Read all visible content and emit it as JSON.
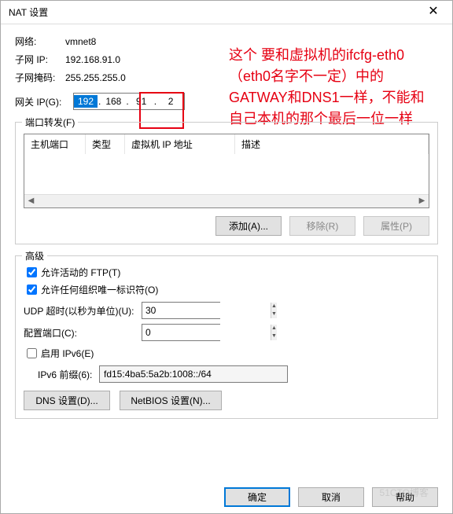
{
  "titlebar": {
    "title": "NAT 设置"
  },
  "info": {
    "network_label": "网络:",
    "network_value": "vmnet8",
    "subnet_ip_label": "子网 IP:",
    "subnet_ip_value": "192.168.91.0",
    "subnet_mask_label": "子网掩码:",
    "subnet_mask_value": "255.255.255.0",
    "gateway_label": "网关 IP(G):",
    "gateway_ip": {
      "o1": "192",
      "o2": "168",
      "o3": "91",
      "o4": "2"
    }
  },
  "port_forward": {
    "legend": "端口转发(F)",
    "columns": {
      "host_port": "主机端口",
      "type": "类型",
      "vm_ip": "虚拟机 IP 地址",
      "desc": "描述"
    },
    "buttons": {
      "add": "添加(A)...",
      "remove": "移除(R)",
      "properties": "属性(P)"
    }
  },
  "advanced": {
    "legend": "高级",
    "allow_ftp": "允许活动的 FTP(T)",
    "allow_oui": "允许任何组织唯一标识符(O)",
    "udp_timeout_label": "UDP 超时(以秒为单位)(U):",
    "udp_timeout_value": "30",
    "config_port_label": "配置端口(C):",
    "config_port_value": "0",
    "enable_ipv6": "启用 IPv6(E)",
    "ipv6_prefix_label": "IPv6 前缀(6):",
    "ipv6_prefix_value": "fd15:4ba5:5a2b:1008::/64",
    "dns_btn": "DNS 设置(D)...",
    "netbios_btn": "NetBIOS 设置(N)..."
  },
  "footer": {
    "ok": "确定",
    "cancel": "取消",
    "help": "帮助"
  },
  "annotation": {
    "text": "这个 要和虚拟机的ifcfg-eth0（eth0名字不一定）中的GATWAY和DNS1一样，不能和自己本机的那个最后一位一样"
  },
  "watermark": "51CTO博客"
}
